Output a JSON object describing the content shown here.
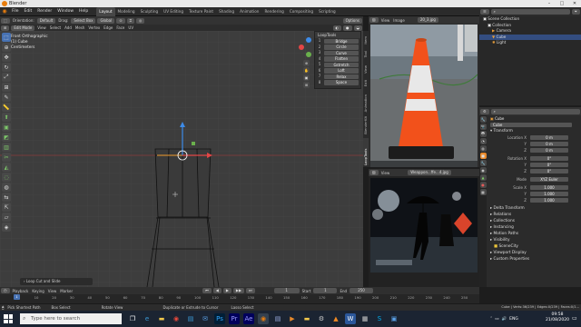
{
  "window": {
    "title": "Blender"
  },
  "menus": [
    "File",
    "Edit",
    "Render",
    "Window",
    "Help"
  ],
  "workspaces": [
    "Layout",
    "Modeling",
    "Sculpting",
    "UV Editing",
    "Texture Paint",
    "Shading",
    "Animation",
    "Rendering",
    "Compositing",
    "Scripting"
  ],
  "active_workspace": "Layout",
  "topright": {
    "scene": "Scene",
    "view_layer": "View Layer"
  },
  "viewport": {
    "orientation_label": "Orientation:",
    "orientation": "Default",
    "drag_label": "Drag:",
    "drag": "Select Box",
    "transform": "Global",
    "mode": "Edit Mode",
    "menus": [
      "View",
      "Select",
      "Add",
      "Mesh",
      "Vertex",
      "Edge",
      "Face",
      "UV"
    ],
    "options": "Options",
    "info": [
      "Front Orthographic",
      "(1) Cube",
      "Centimeters"
    ],
    "last_op": "Loop Cut and Slide"
  },
  "looptools": {
    "title": "LoopTools",
    "items": [
      {
        "key": "1",
        "label": "Bridge"
      },
      {
        "key": "2",
        "label": "Circle"
      },
      {
        "key": "3",
        "label": "Curve"
      },
      {
        "key": "4",
        "label": "Flatten"
      },
      {
        "key": "5",
        "label": "Gstretch"
      },
      {
        "key": "6",
        "label": "Loft"
      },
      {
        "key": "7",
        "label": "Relax"
      },
      {
        "key": "8",
        "label": "Space"
      }
    ]
  },
  "side_tabs": [
    "Item",
    "Tool",
    "View",
    "Edit",
    "Animation",
    "BlenderKit",
    "LoopTools"
  ],
  "image_editor": {
    "view": "View",
    "image": "Image",
    "filename": "20_3.jpg"
  },
  "vse": {
    "view": "View",
    "filename": "Weappon...ffe...4.jpg"
  },
  "outliner": {
    "title": "Scene Collection",
    "items": [
      {
        "label": "Scene Collection",
        "selected": false
      },
      {
        "label": "Collection",
        "selected": false
      },
      {
        "label": "Camera",
        "selected": false
      },
      {
        "label": "Cube",
        "selected": true
      },
      {
        "label": "Light",
        "selected": false
      }
    ]
  },
  "properties": {
    "object_name": "Cube",
    "name_field": "Cube",
    "sections": {
      "transform": "Transform",
      "delta": "Delta Transform",
      "relations": "Relations",
      "collections": "Collections",
      "instancing": "Instancing",
      "motion_paths": "Motion Paths",
      "visibility": "Visibility",
      "viewport_display": "Viewport Display",
      "custom_props": "Custom Properties"
    },
    "location_label": "Location X",
    "loc": [
      "0 m",
      "0 m",
      "0 m"
    ],
    "rotation_label": "Rotation X",
    "rot": [
      "0°",
      "0°",
      "0°"
    ],
    "mode_label": "Mode",
    "mode": "XYZ Euler",
    "scale_label": "Scale X",
    "scale": [
      "1.000",
      "1.000",
      "1.000"
    ],
    "axis_y": "Y",
    "axis_z": "Z",
    "anim_data": "SceneCity"
  },
  "timeline": {
    "menus": [
      "Playback",
      "Keying",
      "View",
      "Marker"
    ],
    "current": "1",
    "start_label": "Start",
    "start": "1",
    "end_label": "End",
    "end": "250",
    "ticks": [
      "0",
      "10",
      "20",
      "30",
      "40",
      "50",
      "60",
      "70",
      "80",
      "90",
      "100",
      "110",
      "120",
      "130",
      "140",
      "150",
      "160",
      "170",
      "180",
      "190",
      "200",
      "210",
      "220",
      "230",
      "240",
      "250"
    ]
  },
  "statusbar": {
    "items": [
      "Pick Shortest Path",
      "Box Select",
      "Rotate View",
      "Duplicate or Extrude to Cursor",
      "Lasso Select"
    ],
    "stats": "Cube | Verts:36/239 | Edges:0/239 | Faces:0/1..."
  },
  "taskbar": {
    "search_placeholder": "Type here to search",
    "lang": "ENG",
    "time": "09:58",
    "date": "21/08/2020"
  }
}
